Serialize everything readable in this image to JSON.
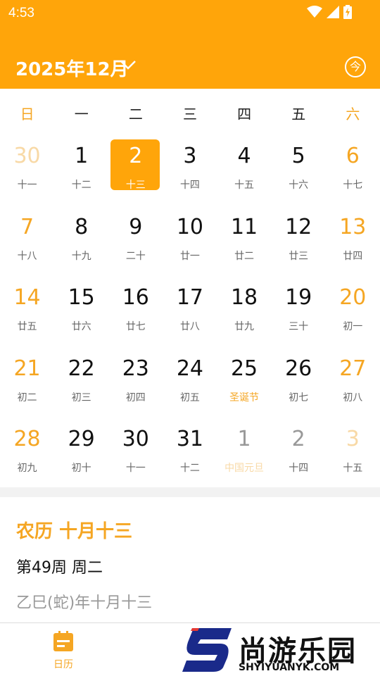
{
  "status_bar": {
    "time": "4:53"
  },
  "header": {
    "month_title": "2025年12月",
    "today_label": "今"
  },
  "weekdays": [
    "日",
    "一",
    "二",
    "三",
    "四",
    "五",
    "六"
  ],
  "calendar": {
    "weeks": [
      [
        {
          "day": "30",
          "lunar": "十一",
          "other": true
        },
        {
          "day": "1",
          "lunar": "十二"
        },
        {
          "day": "2",
          "lunar": "十三",
          "selected": true
        },
        {
          "day": "3",
          "lunar": "十四"
        },
        {
          "day": "4",
          "lunar": "十五"
        },
        {
          "day": "5",
          "lunar": "十六"
        },
        {
          "day": "6",
          "lunar": "十七"
        }
      ],
      [
        {
          "day": "7",
          "lunar": "十八"
        },
        {
          "day": "8",
          "lunar": "十九"
        },
        {
          "day": "9",
          "lunar": "二十"
        },
        {
          "day": "10",
          "lunar": "廿一"
        },
        {
          "day": "11",
          "lunar": "廿二"
        },
        {
          "day": "12",
          "lunar": "廿三"
        },
        {
          "day": "13",
          "lunar": "廿四"
        }
      ],
      [
        {
          "day": "14",
          "lunar": "廿五"
        },
        {
          "day": "15",
          "lunar": "廿六"
        },
        {
          "day": "16",
          "lunar": "廿七"
        },
        {
          "day": "17",
          "lunar": "廿八"
        },
        {
          "day": "18",
          "lunar": "廿九"
        },
        {
          "day": "19",
          "lunar": "三十"
        },
        {
          "day": "20",
          "lunar": "初一"
        }
      ],
      [
        {
          "day": "21",
          "lunar": "初二"
        },
        {
          "day": "22",
          "lunar": "初三"
        },
        {
          "day": "23",
          "lunar": "初四"
        },
        {
          "day": "24",
          "lunar": "初五"
        },
        {
          "day": "25",
          "lunar": "圣诞节",
          "festival": true
        },
        {
          "day": "26",
          "lunar": "初七"
        },
        {
          "day": "27",
          "lunar": "初八"
        }
      ],
      [
        {
          "day": "28",
          "lunar": "初九"
        },
        {
          "day": "29",
          "lunar": "初十"
        },
        {
          "day": "30",
          "lunar": "十一"
        },
        {
          "day": "31",
          "lunar": "十二"
        },
        {
          "day": "1",
          "lunar": "中国元旦",
          "other": true,
          "festival": true
        },
        {
          "day": "2",
          "lunar": "十四",
          "other": true
        },
        {
          "day": "3",
          "lunar": "十五",
          "other": true
        }
      ]
    ]
  },
  "info": {
    "lunar_date": "农历 十月十三",
    "week_info": "第49周 周二",
    "ganzhi": "乙巳(蛇)年十月十三"
  },
  "bottom_nav": {
    "calendar_label": "日历"
  },
  "watermark": {
    "text": "尚游乐园",
    "url": "SHYIYUANYK.COM"
  },
  "colors": {
    "accent": "#FFA50A",
    "weekend": "#F5A623"
  }
}
